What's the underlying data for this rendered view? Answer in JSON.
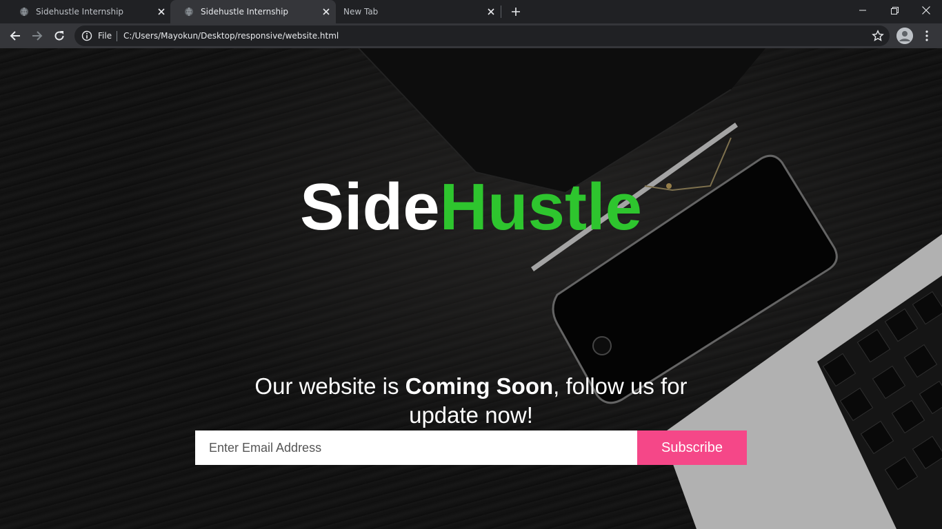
{
  "browser": {
    "tabs": [
      {
        "title": "Sidehustle Internship",
        "active": false
      },
      {
        "title": "Sidehustle Internship",
        "active": true
      },
      {
        "title": "New Tab",
        "active": false
      }
    ],
    "address_scheme_label": "File",
    "address_url": "C:/Users/Mayokun/Desktop/responsive/website.html",
    "icons": [
      "globe-icon",
      "close-icon",
      "plus-icon",
      "minimize-icon",
      "restore-icon",
      "window-close-icon",
      "back-icon",
      "forward-icon",
      "reload-icon",
      "info-icon",
      "star-icon",
      "avatar-icon",
      "kebab-menu-icon"
    ]
  },
  "page": {
    "brand": {
      "part1": "Side",
      "part2": "Hustle"
    },
    "tagline": {
      "before": "Our website is ",
      "emphasis": "Coming Soon",
      "after": ", follow us for update now!"
    },
    "signup": {
      "email_placeholder": "Enter Email Address",
      "button_label": "Subscribe"
    }
  },
  "colors": {
    "brand_white": "#ffffff",
    "brand_green": "#2ec52e",
    "subscribe_bg": "#f54788",
    "chrome_dark": "#202124",
    "chrome_toolbar": "#35363a"
  }
}
